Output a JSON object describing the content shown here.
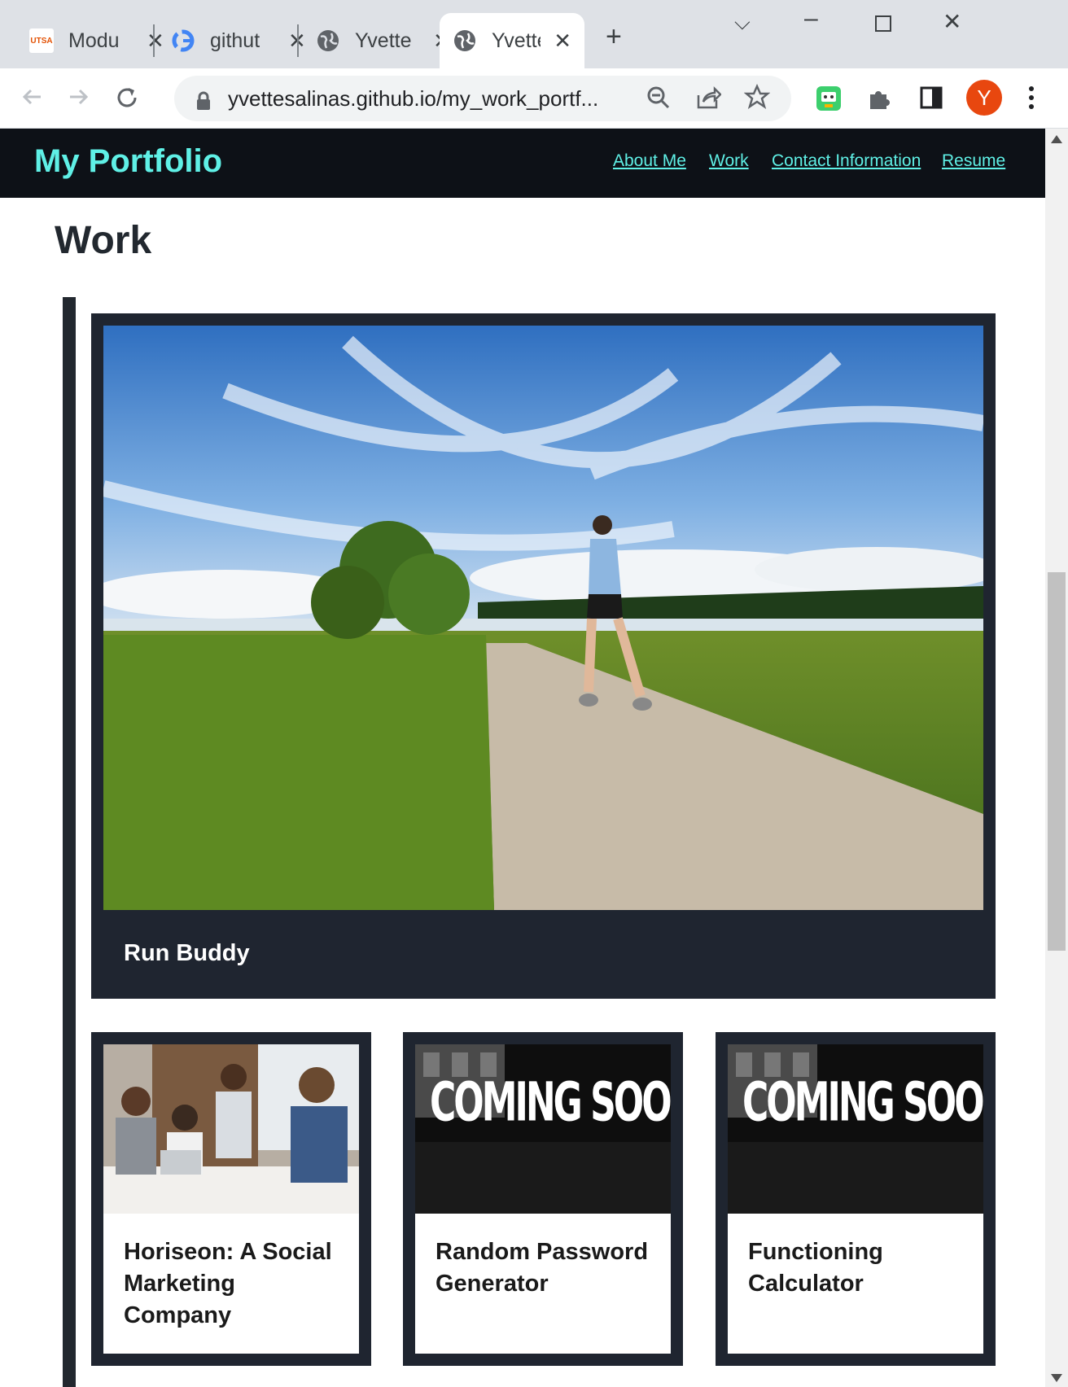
{
  "browser": {
    "tabs": [
      {
        "title": "Modu",
        "favicon": "utsa-icon"
      },
      {
        "title": "githut",
        "favicon": "google-icon"
      },
      {
        "title": "Yvette",
        "favicon": "globe-icon"
      },
      {
        "title": "Yvette",
        "favicon": "globe-icon",
        "active": true
      }
    ],
    "favicon_text": "UTSA",
    "url": "yvettesalinas.github.io/my_work_portf...",
    "avatar_letter": "Y"
  },
  "site": {
    "brand": "My Portfolio",
    "nav": [
      "About Me",
      "Work",
      "Contact Information",
      "Resume"
    ]
  },
  "work": {
    "heading": "Work",
    "featured": {
      "title": "Run Buddy"
    },
    "cards": [
      {
        "title": "Horiseon: A Social Marketing Company",
        "image": "team-meeting-photo"
      },
      {
        "title": "Random Password Generator",
        "image": "coming-soon-photo"
      },
      {
        "title": "Functioning Calculator",
        "image": "coming-soon-photo"
      }
    ],
    "coming_soon_text": "COMING SOON"
  },
  "colors": {
    "nav_bg": "#0d1117",
    "accent": "#5ff0e6",
    "card_bg": "#1f2530"
  }
}
